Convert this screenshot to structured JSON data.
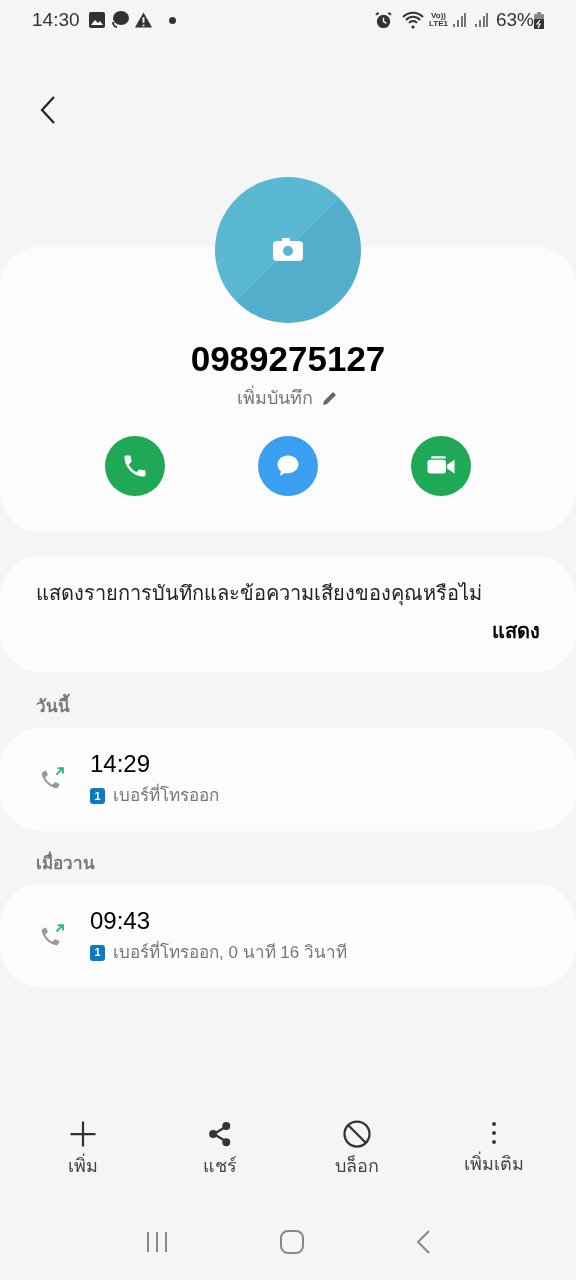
{
  "status_bar": {
    "time": "14:30",
    "network_top": "Vo))",
    "network_bottom": "LTE1",
    "battery": "63%"
  },
  "contact": {
    "number": "0989275127",
    "note_label": "เพิ่มบันทึก"
  },
  "actions": [
    {
      "kind": "call"
    },
    {
      "kind": "message"
    },
    {
      "kind": "video"
    }
  ],
  "recording_prompt": {
    "text": "แสดงรายการบันทึกและข้อความเสียงของคุณหรือไม่",
    "button": "แสดง"
  },
  "call_groups": [
    {
      "heading": "วันนี้",
      "calls": [
        {
          "kind": "outgoing",
          "time": "14:29",
          "sim": "1",
          "detail": "เบอร์ที่โทรออก"
        }
      ]
    },
    {
      "heading": "เมื่อวาน",
      "calls": [
        {
          "kind": "outgoing",
          "time": "09:43",
          "sim": "1",
          "detail": "เบอร์ที่โทรออก, 0 นาที 16 วินาที"
        }
      ]
    }
  ],
  "bottom_actions": [
    {
      "kind": "add",
      "label": "เพิ่ม"
    },
    {
      "kind": "share",
      "label": "แชร์"
    },
    {
      "kind": "block",
      "label": "บล็อก"
    },
    {
      "kind": "more",
      "label": "เพิ่มเติม"
    }
  ]
}
